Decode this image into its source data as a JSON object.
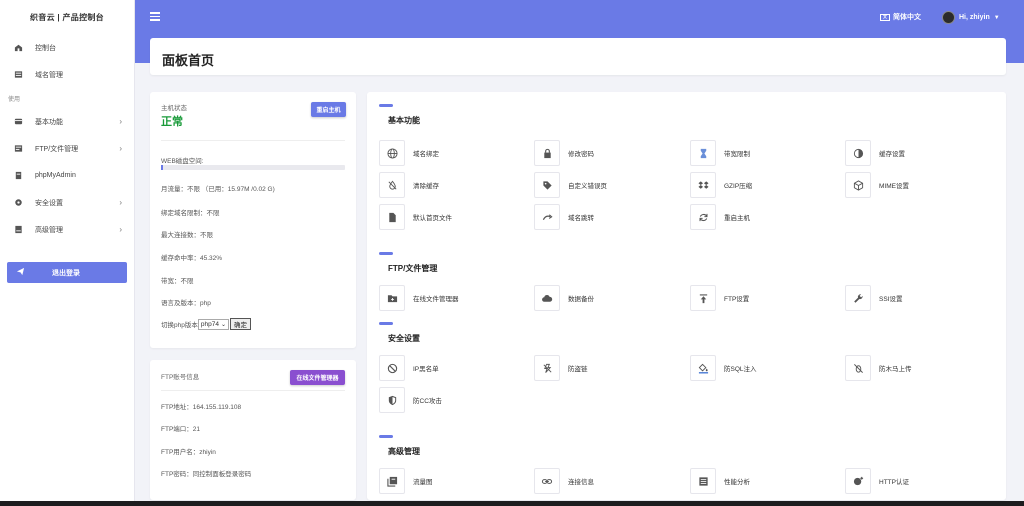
{
  "brand": "织音云 | 产品控制台",
  "sidebar": {
    "top_items": [
      {
        "label": "控制台",
        "icon": "dashboard-icon"
      },
      {
        "label": "域名管理",
        "icon": "domain-icon"
      }
    ],
    "section_label": "使用",
    "items": [
      {
        "label": "基本功能",
        "icon": "basic-icon",
        "chevron": true
      },
      {
        "label": "FTP/文件管理",
        "icon": "ftp-icon",
        "chevron": true
      },
      {
        "label": "phpMyAdmin",
        "icon": "database-icon",
        "chevron": false
      },
      {
        "label": "安全设置",
        "icon": "gear-icon",
        "chevron": true
      },
      {
        "label": "高级管理",
        "icon": "advanced-icon",
        "chevron": true
      }
    ],
    "logout_label": "退出登录"
  },
  "header": {
    "language": "简体中文",
    "user": "Hi, zhiyin"
  },
  "page_title": "面板首页",
  "host": {
    "status_label": "主机状态",
    "status_value": "正常",
    "restart_label": "重启主机",
    "disk_label": "WEB磁盘空间:",
    "disk_usage_fraction": 0.01,
    "traffic": "月流量：不限 （已用：15.97M /0.02 G)",
    "bind_limit": "绑定域名限制：不限",
    "max_conn": "最大连接数：不限",
    "cache_hit": "缓存命中率：45.32%",
    "bandwidth": "带宽：不限",
    "lang_version": "语言及版本：php",
    "switch_php_label": "切换php版本",
    "php_selected": "php74",
    "confirm_label": "确定"
  },
  "ftp": {
    "title": "FTP账号信息",
    "manager_button": "在线文件管理器",
    "address": "FTP地址：164.155.119.108",
    "port": "FTP端口：21",
    "username": "FTP用户名：zhiyin",
    "password": "FTP密码：同控制面板登录密码"
  },
  "sections": [
    {
      "title": "基本功能",
      "items": [
        {
          "label": "域名绑定",
          "icon": "globe-icon"
        },
        {
          "label": "修改密码",
          "icon": "lock-icon"
        },
        {
          "label": "带宽限制",
          "icon": "hourglass-icon"
        },
        {
          "label": "缓存设置",
          "icon": "contrast-icon"
        },
        {
          "label": "清除缓存",
          "icon": "no-drop-icon"
        },
        {
          "label": "自定义错误页",
          "icon": "tag-icon"
        },
        {
          "label": "GZIP压缩",
          "icon": "dropbox-icon"
        },
        {
          "label": "MIME设置",
          "icon": "cube-icon"
        },
        {
          "label": "默认首页文件",
          "icon": "file-icon"
        },
        {
          "label": "域名跳转",
          "icon": "redirect-icon"
        },
        {
          "label": "重启主机",
          "icon": "refresh-icon"
        }
      ]
    },
    {
      "title": "FTP/文件管理",
      "items": [
        {
          "label": "在线文件管理器",
          "icon": "folder-plus-icon"
        },
        {
          "label": "数据备份",
          "icon": "cloud-icon"
        },
        {
          "label": "FTP设置",
          "icon": "upload-icon"
        },
        {
          "label": "SSI设置",
          "icon": "wrench-icon"
        }
      ]
    },
    {
      "title": "安全设置",
      "items": [
        {
          "label": "IP黑名单",
          "icon": "ban-icon"
        },
        {
          "label": "防盗链",
          "icon": "broken-link-icon"
        },
        {
          "label": "防SQL注入",
          "icon": "paint-bucket-icon"
        },
        {
          "label": "防木马上传",
          "icon": "bug-off-icon"
        },
        {
          "label": "防CC攻击",
          "icon": "shield-icon"
        }
      ]
    },
    {
      "title": "高级管理",
      "items": [
        {
          "label": "流量图",
          "icon": "chart-icon"
        },
        {
          "label": "连接信息",
          "icon": "link-icon"
        },
        {
          "label": "性能分析",
          "icon": "list-icon"
        },
        {
          "label": "HTTP认证",
          "icon": "user-plus-icon"
        }
      ]
    }
  ],
  "colors": {
    "accent": "#6a7ae6",
    "status_ok": "#1a9b3a",
    "ftp_button": "#8a4fd0"
  }
}
